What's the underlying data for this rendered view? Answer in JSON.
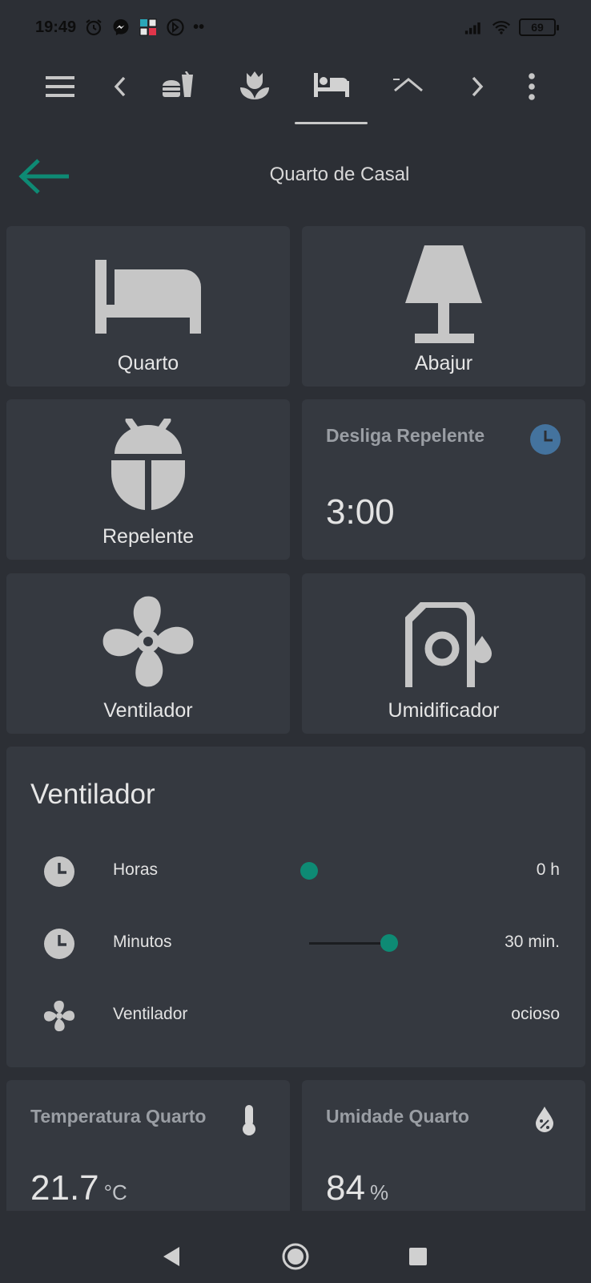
{
  "status_bar": {
    "time": "19:49",
    "battery": "69",
    "extra": "••"
  },
  "topnav": {
    "icons": [
      "menu-icon",
      "chevron-left-icon",
      "food-drink-icon",
      "flower-icon",
      "bed-icon",
      "roof-icon",
      "chevron-right-icon",
      "more-vert-icon"
    ],
    "active_tab": "bed-icon"
  },
  "header": {
    "title": "Quarto de Casal"
  },
  "buttons": {
    "quarto": "Quarto",
    "abajur": "Abajur",
    "repelente": "Repelente",
    "ventilador": "Ventilador",
    "umidificador": "Umidificador"
  },
  "timer_card": {
    "title": "Desliga Repelente",
    "value": "3:00"
  },
  "entities": {
    "title": "Ventilador",
    "rows": [
      {
        "name": "Horas",
        "value": "0 h",
        "slider_fraction": 0
      },
      {
        "name": "Minutos",
        "value": "30 min.",
        "slider_fraction": 0.5
      },
      {
        "name": "Ventilador",
        "value": "ocioso"
      }
    ]
  },
  "sensors": {
    "temperatura": {
      "title": "Temperatura Quarto",
      "value": "21.7",
      "unit": "°C"
    },
    "umidade": {
      "title": "Umidade Quarto",
      "value": "84",
      "unit": "%"
    }
  },
  "colors": {
    "accent": "#0e8a74",
    "background": "#2c2f35",
    "card": "#353940",
    "icon": "#c6c6c6",
    "timer_icon": "#44739e"
  }
}
